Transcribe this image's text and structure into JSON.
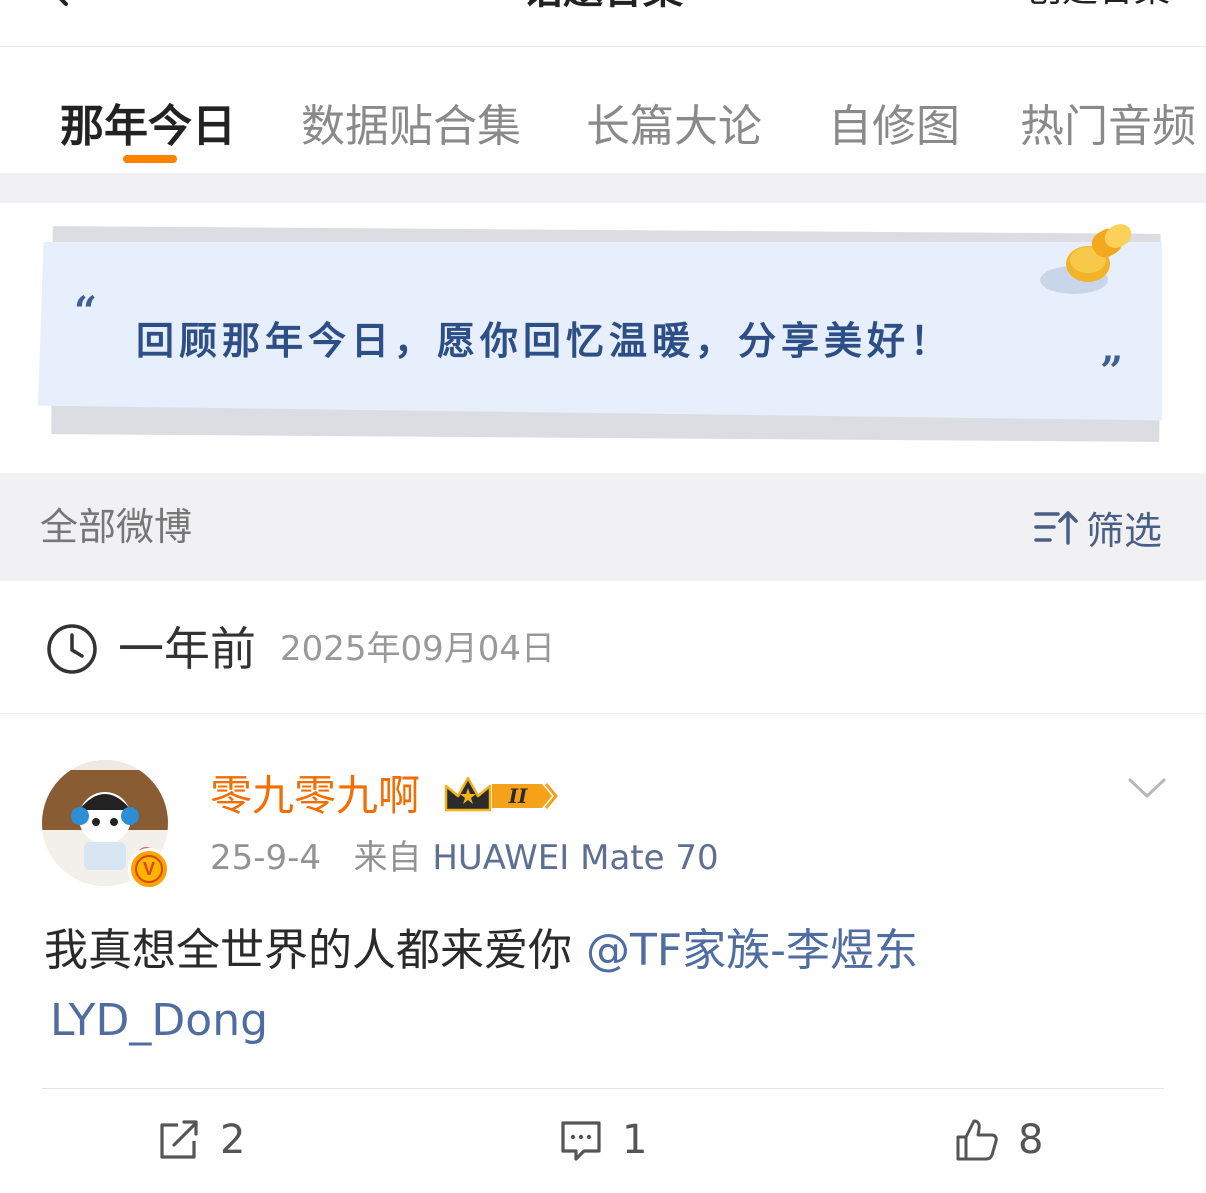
{
  "topbar": {
    "title": "话题合集",
    "right_action": "创建合集"
  },
  "tabs": [
    {
      "label": "那年今日",
      "active": true
    },
    {
      "label": "数据贴合集",
      "active": false
    },
    {
      "label": "长篇大论",
      "active": false
    },
    {
      "label": "自修图",
      "active": false
    },
    {
      "label": "热门音频",
      "active": false
    }
  ],
  "banner": {
    "quote_open": "“",
    "text": "回顾那年今日，愿你回忆温暖，分享美好！",
    "quote_close": "”",
    "icon": "pin-icon"
  },
  "filter": {
    "label": "全部微博",
    "button_label": "筛选",
    "icon": "filter-sort-icon"
  },
  "date_section": {
    "icon": "clock-icon",
    "relative": "一年前",
    "full_date": "2025年09月04日"
  },
  "post": {
    "username": "零九零九啊",
    "badge_level": "II",
    "verified_badge": "V",
    "date": "25-9-4",
    "source_prefix": "来自",
    "device": "HUAWEI Mate 70",
    "text": "我真想全世界的人都来爱你 ",
    "mention_line1": "@TF家族-李煜东",
    "mention_line2": "LYD_Dong",
    "actions": {
      "repost_count": "2",
      "comment_count": "1",
      "like_count": "8"
    }
  },
  "colors": {
    "accent_orange": "#ff8200",
    "link_blue": "#4f6da1",
    "username_orange": "#f36d00",
    "bg_gray": "#f1f1f3"
  }
}
